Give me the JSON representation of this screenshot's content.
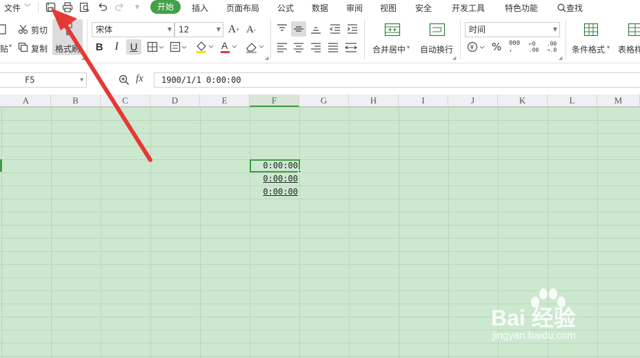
{
  "menubar": {
    "file_label": "文件",
    "tabs": [
      "插入",
      "页面布局",
      "公式",
      "数据",
      "审阅",
      "视图",
      "安全",
      "开发工具",
      "特色功能"
    ],
    "active_tab": "开始",
    "search_label": "查找"
  },
  "ribbon": {
    "paste_label": "贴",
    "cut_label": "剪切",
    "copy_label": "复制",
    "format_painter_label": "格式刷",
    "font_name": "宋体",
    "font_size": "12",
    "merge_label": "合并居中",
    "wrap_label": "自动换行",
    "number_format": "时间",
    "conditional_format_label": "条件格式",
    "table_style_label": "表格样"
  },
  "formula_bar": {
    "cell_ref": "F5",
    "fx_label": "fx",
    "formula": "1900/1/1 0:00:00"
  },
  "sheet": {
    "columns": [
      "A",
      "B",
      "C",
      "D",
      "E",
      "F",
      "G",
      "H",
      "I",
      "J",
      "K",
      "L",
      "M"
    ],
    "selected_column": "F",
    "cells": [
      "0:00:00",
      "0:00:00",
      "0:00:00"
    ],
    "accent_color": "#3f9b45",
    "sheet_background": "#cce8cf",
    "arrow_color": "#e53935"
  },
  "watermark": {
    "brand": "Bai 经验",
    "url": "jingyan.baidu.com"
  }
}
